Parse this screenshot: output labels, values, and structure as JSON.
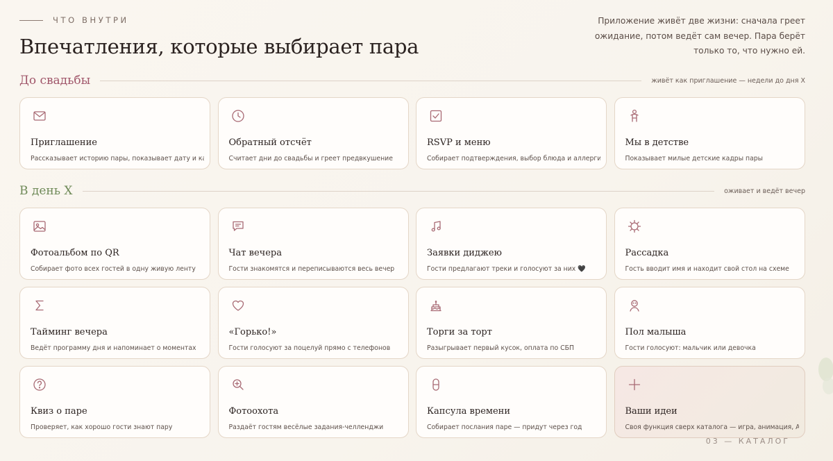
{
  "header": {
    "eyebrow": "ЧТО ВНУТРИ",
    "title": "Впечатления, которые выбирает пара",
    "intro": "Приложение живёт две жизни: сначала греет ожидание, потом ведёт сам вечер. Пара берёт только то, что нужно ей."
  },
  "colors": {
    "accent_rose": "#a0566a",
    "accent_green": "#6f8a58",
    "icon": "#a86a74"
  },
  "sections": [
    {
      "title": "До свадьбы",
      "note": "живёт как приглашение — недели до дня Х",
      "cards": [
        {
          "icon": "envelope-icon",
          "name": "Приглашение",
          "desc": "Рассказывает историю пары, показывает дату и карту"
        },
        {
          "icon": "clock-icon",
          "name": "Обратный отсчёт",
          "desc": "Считает дни до свадьбы и греет предвкушение"
        },
        {
          "icon": "checkbox-icon",
          "name": "RSVP и меню",
          "desc": "Собирает подтверждения, выбор блюда и аллергии"
        },
        {
          "icon": "child-icon",
          "name": "Мы в детстве",
          "desc": "Показывает милые детские кадры пары"
        }
      ]
    },
    {
      "title": "В день Х",
      "note": "оживает и ведёт вечер",
      "cards": [
        {
          "icon": "image-icon",
          "name": "Фотоальбом по QR",
          "desc": "Собирает фото всех гостей в одну живую ленту"
        },
        {
          "icon": "chat-icon",
          "name": "Чат вечера",
          "desc": "Гости знакомятся и переписываются весь вечер"
        },
        {
          "icon": "music-note-icon",
          "name": "Заявки диджею",
          "desc": "Гости предлагают треки и голосуют за них 🖤"
        },
        {
          "icon": "seating-table-icon",
          "name": "Рассадка",
          "desc": "Гость вводит имя и находит свой стол на схеме"
        },
        {
          "icon": "sigma-icon",
          "name": "Тайминг вечера",
          "desc": "Ведёт программу дня и напоминает о моментах"
        },
        {
          "icon": "heart-icon",
          "name": "«Горько!»",
          "desc": "Гости голосуют за поцелуй прямо с телефонов"
        },
        {
          "icon": "cake-icon",
          "name": "Торги за торт",
          "desc": "Разыгрывает первый кусок, оплата по СБП"
        },
        {
          "icon": "baby-icon",
          "name": "Пол малыша",
          "desc": "Гости голосуют: мальчик или девочка"
        },
        {
          "icon": "question-icon",
          "name": "Квиз о паре",
          "desc": "Проверяет, как хорошо гости знают пару"
        },
        {
          "icon": "zoom-in-icon",
          "name": "Фотоохота",
          "desc": "Раздаёт гостям весёлые задания-челленджи"
        },
        {
          "icon": "capsule-icon",
          "name": "Капсула времени",
          "desc": "Собирает послания паре — придут через год"
        },
        {
          "icon": "plus-icon",
          "name": "Ваши идеи",
          "desc": "Своя функция сверх каталога — игра, анимация, AI."
        }
      ]
    }
  ],
  "footer": "03 — КАТАЛОГ"
}
